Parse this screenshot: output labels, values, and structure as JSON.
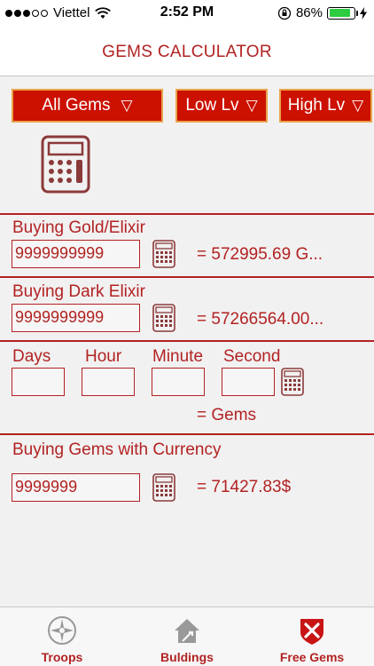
{
  "status": {
    "carrier": "Viettel",
    "time": "2:52 PM",
    "battery": "86%",
    "battery_level": 0.86
  },
  "nav": {
    "title": "GEMS CALCULATOR"
  },
  "filters": {
    "gems": {
      "label": "All Gems",
      "arrow": "▽"
    },
    "low": {
      "label": "Low Lv",
      "arrow": "▽"
    },
    "high": {
      "label": "High Lv",
      "arrow": "▽"
    }
  },
  "gold_elixir": {
    "label": "Buying Gold/Elixir",
    "value": "9999999999",
    "result": "= 572995.69 G..."
  },
  "dark_elixir": {
    "label": "Buying Dark Elixir",
    "value": "9999999999",
    "result": "= 57266564.00..."
  },
  "time_calc": {
    "days_label": "Days",
    "hour_label": "Hour",
    "minute_label": "Minute",
    "second_label": "Second",
    "days_value": "",
    "hour_value": "",
    "minute_value": "",
    "second_value": "",
    "result": "=  Gems"
  },
  "currency": {
    "label": "Buying Gems with Currency",
    "value": "9999999",
    "result": "= 71427.83$"
  },
  "tabs": [
    {
      "label": "Troops",
      "icon": "troops-icon"
    },
    {
      "label": "Buldings",
      "icon": "buildings-icon"
    },
    {
      "label": "Free Gems",
      "icon": "free-gems-icon"
    }
  ],
  "colors": {
    "accent": "#b22222",
    "dropdown_bg": "#cc1100",
    "dropdown_border": "#e8a34a",
    "background": "#f2f1f1"
  }
}
